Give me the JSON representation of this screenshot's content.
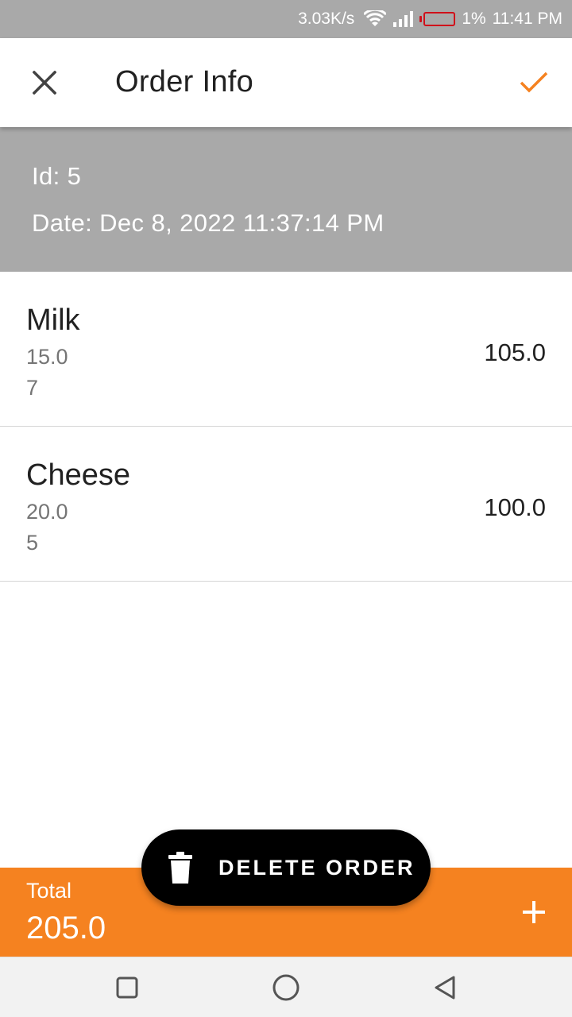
{
  "status_bar": {
    "net_speed": "3.03K/s",
    "battery_percent": "1%",
    "time": "11:41 PM",
    "battery_color": "#d0101a"
  },
  "app_bar": {
    "title": "Order Info",
    "close_icon": "close-icon",
    "confirm_icon": "check-icon",
    "confirm_color": "#f58220"
  },
  "order": {
    "id_text": "Id: 5",
    "date_text": "Date: Dec 8, 2022 11:37:14 PM"
  },
  "items": [
    {
      "name": "Milk",
      "price": "15.0",
      "quantity": "7",
      "total": "105.0"
    },
    {
      "name": "Cheese",
      "price": "20.0",
      "quantity": "5",
      "total": "100.0"
    }
  ],
  "footer": {
    "total_label": "Total",
    "total_value": "205.0",
    "add_icon": "plus-icon",
    "background_color": "#f58220"
  },
  "delete_button": {
    "label": "DELETE ORDER",
    "icon": "trash-icon"
  },
  "nav": {
    "recent_icon": "square-icon",
    "home_icon": "circle-icon",
    "back_icon": "triangle-back-icon"
  }
}
